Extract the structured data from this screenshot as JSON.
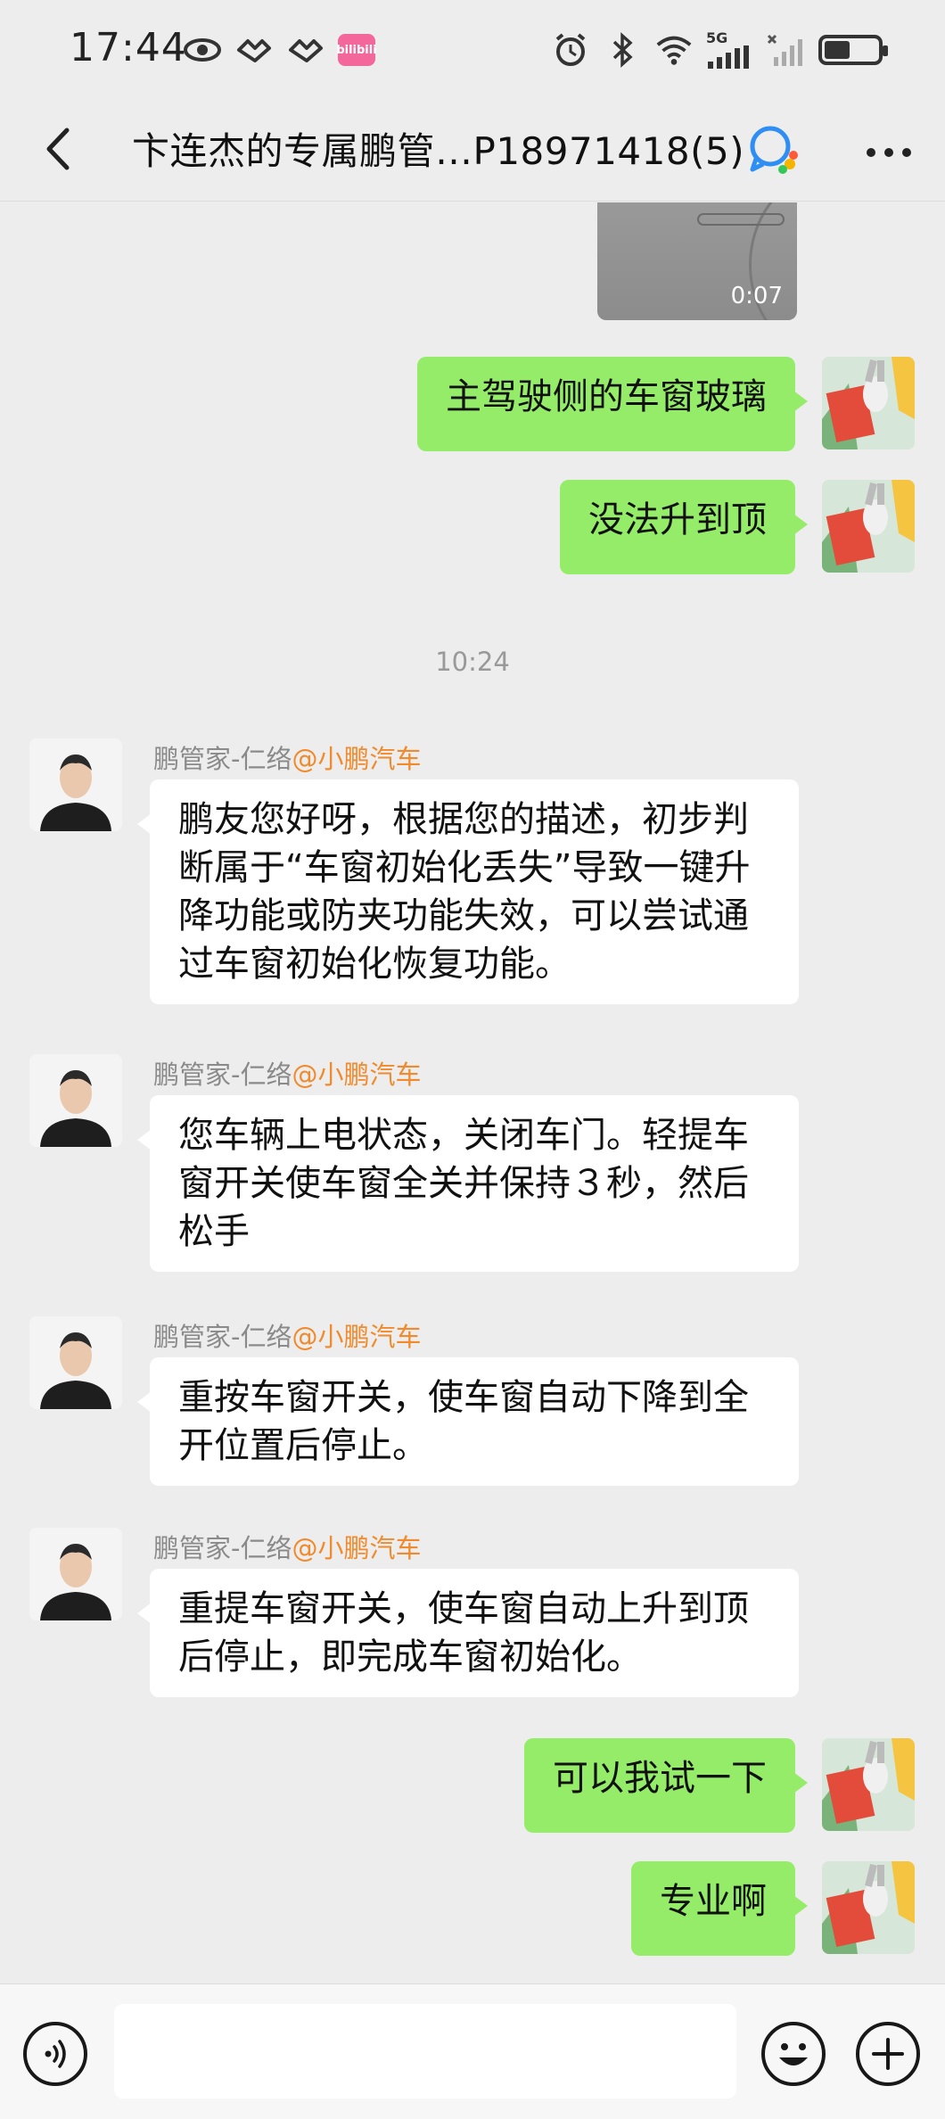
{
  "status_bar": {
    "time": "17:44",
    "app_badge": "bilibili",
    "network": "5G"
  },
  "header": {
    "title": "卞连杰的专属鹏管…P18971418(5)"
  },
  "messages": {
    "video": {
      "duration": "0:07"
    },
    "out1": "主驾驶侧的车窗玻璃",
    "out2": "没法升到顶",
    "time_divider": "10:24",
    "sender_name": "鹏管家-仁络",
    "sender_org": "@小鹏汽车",
    "in1": "鹏友您好呀，根据您的描述，初步判断属于“车窗初始化丢失”导致一键升降功能或防夹功能失效，可以尝试通过车窗初始化恢复功能。",
    "in2": "您车辆上电状态，关闭车门。轻提车窗开关使车窗全关并保持３秒，然后松手",
    "in3": "重按车窗开关，使车窗自动下降到全开位置后停止。",
    "in4": "重提车窗开关，使车窗自动上升到顶后停止，即完成车窗初始化。",
    "out3": "可以我试一下",
    "out4": "专业啊"
  },
  "input": {
    "placeholder": ""
  },
  "colors": {
    "background": "#ededed",
    "outgoing_bubble": "#95ec69",
    "incoming_bubble": "#ffffff",
    "org_label": "#f08a2c"
  }
}
